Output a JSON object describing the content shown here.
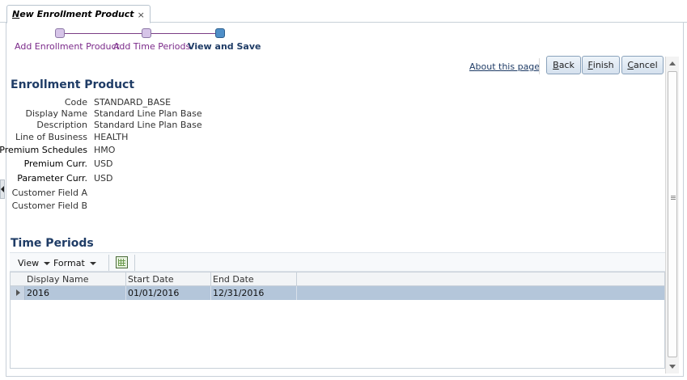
{
  "tab": {
    "title_underlined": "N",
    "title_rest": "ew Enrollment Product",
    "close_glyph": "×"
  },
  "train": {
    "steps": [
      {
        "label": "Add Enrollment Product",
        "state": "visited"
      },
      {
        "label": "Add Time Periods",
        "state": "visited"
      },
      {
        "label": "View and Save",
        "state": "current"
      }
    ]
  },
  "toolbar": {
    "about_link": "About this page",
    "back_ul": "B",
    "back_rest": "ack",
    "finish_ul": "F",
    "finish_rest": "inish",
    "cancel_ul": "C",
    "cancel_rest": "ancel"
  },
  "enrollment": {
    "title": "Enrollment Product",
    "fields": [
      {
        "label": "Code",
        "value": "STANDARD_BASE"
      },
      {
        "label": "Display Name",
        "value": "Standard Line Plan Base"
      },
      {
        "label": "Description",
        "value": "Standard Line Plan Base"
      },
      {
        "label": "Line of Business",
        "value": "HEALTH"
      },
      {
        "label": "Premium Schedules",
        "value": "HMO"
      },
      {
        "label": "Premium Curr.",
        "value": "USD"
      },
      {
        "label": "Parameter Curr.",
        "value": "USD"
      },
      {
        "label": "Customer Field A",
        "value": ""
      },
      {
        "label": "Customer Field B",
        "value": ""
      }
    ]
  },
  "time_periods": {
    "title": "Time Periods",
    "menu_view": "View",
    "menu_format": "Format",
    "export_icon": "excel-export-icon",
    "columns": [
      "Display Name",
      "Start Date",
      "End Date"
    ],
    "rows": [
      {
        "display_name": "2016",
        "start_date": "01/01/2016",
        "end_date": "12/31/2016"
      }
    ]
  },
  "colors": {
    "accent": "#1f3c66",
    "train_link": "#7b2a8a",
    "selected_row": "#b4c6da"
  }
}
